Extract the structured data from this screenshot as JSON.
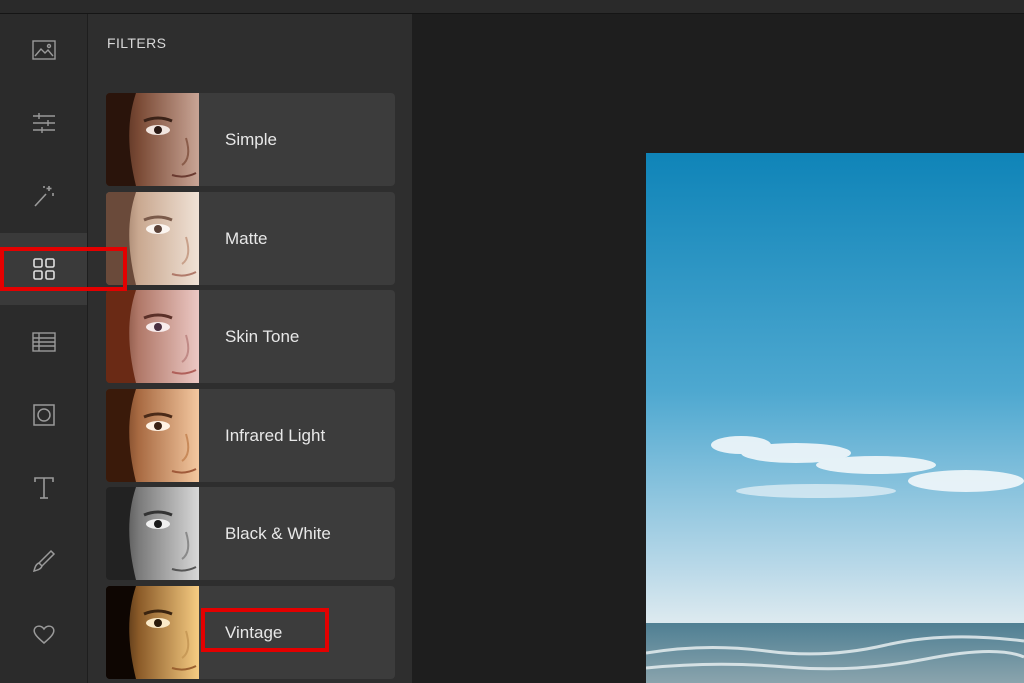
{
  "panel": {
    "title": "FILTERS"
  },
  "rail": {
    "items": [
      {
        "icon": "image-icon",
        "active": false
      },
      {
        "icon": "sliders-icon",
        "active": false
      },
      {
        "icon": "magic-wand-icon",
        "active": false
      },
      {
        "icon": "grid-icon",
        "active": true
      },
      {
        "icon": "texture-icon",
        "active": false
      },
      {
        "icon": "frame-icon",
        "active": false
      },
      {
        "icon": "text-icon",
        "active": false
      },
      {
        "icon": "brush-icon",
        "active": false
      },
      {
        "icon": "heart-icon",
        "active": false
      }
    ]
  },
  "filters": [
    {
      "label": "Simple",
      "tone": "natural"
    },
    {
      "label": "Matte",
      "tone": "matte"
    },
    {
      "label": "Skin Tone",
      "tone": "rosy"
    },
    {
      "label": "Infrared Light",
      "tone": "warm"
    },
    {
      "label": "Black & White",
      "tone": "mono"
    },
    {
      "label": "Vintage",
      "tone": "vintage"
    }
  ],
  "colors": {
    "accent_highlight": "#e40000",
    "panel_bg": "#2e2e2e",
    "card_bg": "#3c3c3c",
    "rail_active_bg": "#3a3a3a"
  }
}
